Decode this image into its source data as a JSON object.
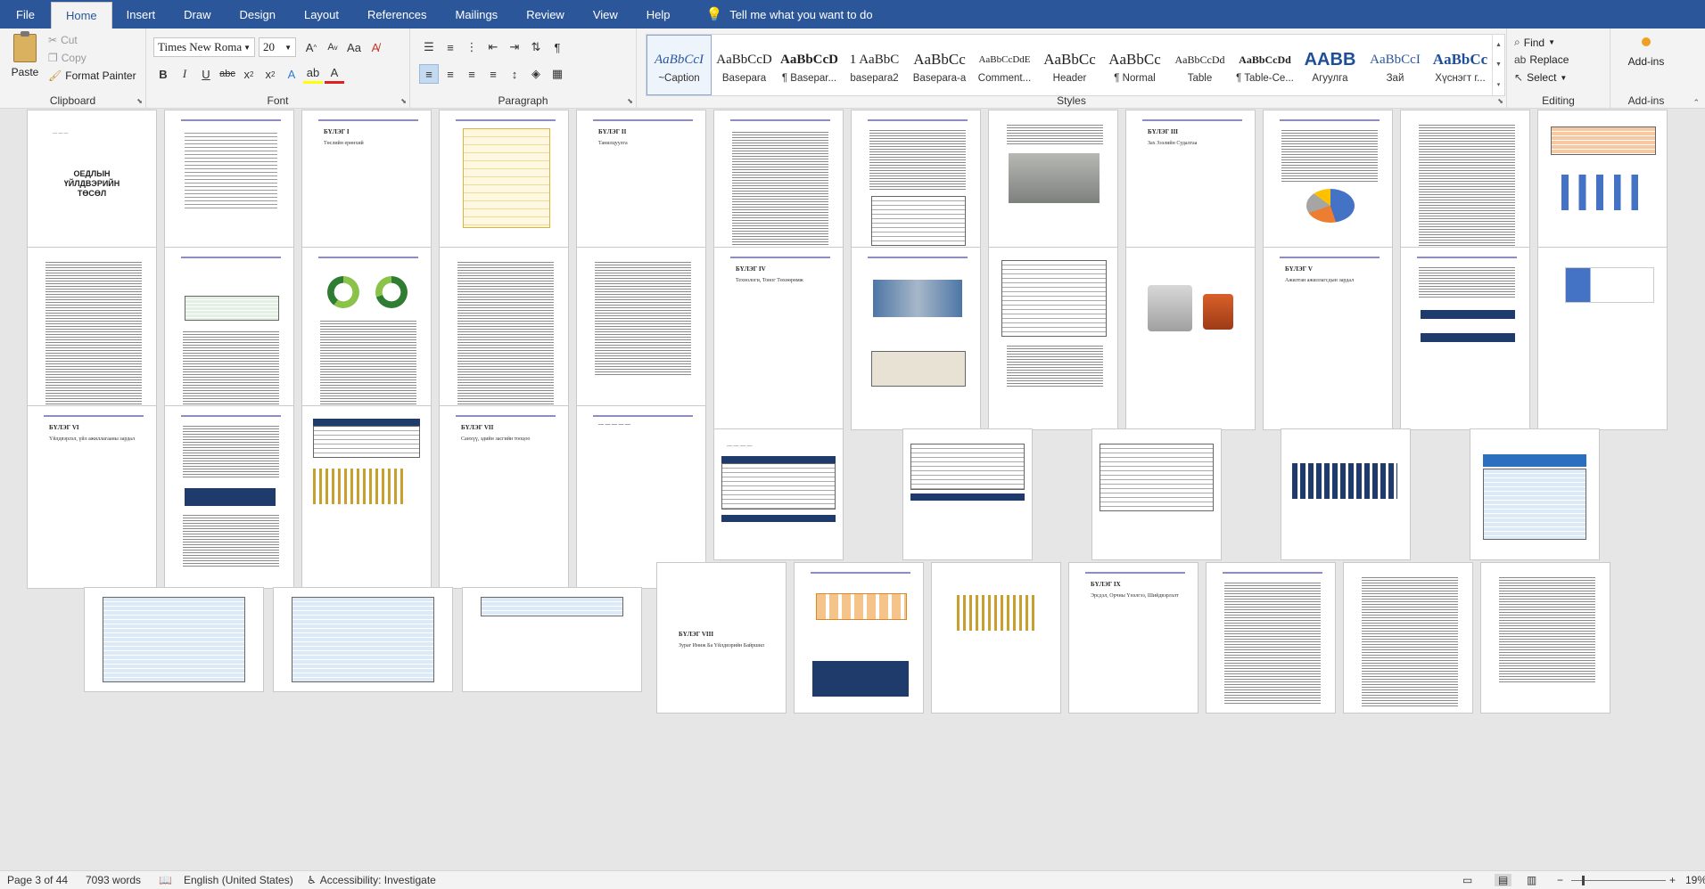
{
  "menu": {
    "tabs": [
      "File",
      "Home",
      "Insert",
      "Draw",
      "Design",
      "Layout",
      "References",
      "Mailings",
      "Review",
      "View",
      "Help"
    ],
    "active": "Home",
    "tellme": "Tell me what you want to do"
  },
  "clipboard": {
    "paste": "Paste",
    "cut": "Cut",
    "copy": "Copy",
    "format_painter": "Format Painter",
    "label": "Clipboard"
  },
  "font": {
    "name": "Times New Roma",
    "size": "20",
    "label": "Font"
  },
  "paragraph": {
    "label": "Paragraph"
  },
  "styles": {
    "label": "Styles",
    "items": [
      {
        "preview": "AaBbCcI",
        "name": "~Caption"
      },
      {
        "preview": "AaBbCcD",
        "name": "Basepara"
      },
      {
        "preview": "AaBbCcD",
        "name": "¶ Basepar..."
      },
      {
        "preview": "1 AaBbC",
        "name": "basepara2"
      },
      {
        "preview": "AaBbCc",
        "name": "Basepara-a"
      },
      {
        "preview": "AaBbCcDdE",
        "name": "Comment..."
      },
      {
        "preview": "AaBbCc",
        "name": "Header"
      },
      {
        "preview": "AaBbCc",
        "name": "¶ Normal"
      },
      {
        "preview": "AaBbCcDd",
        "name": "Table"
      },
      {
        "preview": "AaBbCcDd",
        "name": "¶ Table-Ce..."
      },
      {
        "preview": "AABB",
        "name": "Агуулга"
      },
      {
        "preview": "AaBbCcI",
        "name": "Зай"
      },
      {
        "preview": "AaBbCc",
        "name": "Хүснэгт г..."
      }
    ]
  },
  "editing": {
    "find": "Find",
    "replace": "Replace",
    "select": "Select",
    "label": "Editing"
  },
  "addins": {
    "button": "Add-ins",
    "label": "Add-ins"
  },
  "pages": {
    "cover_title": "ОЕДЛЫН ҮЙЛДВЭРИЙН ТӨСӨЛ",
    "ch1": "БҮЛЭГ I",
    "ch1_sub": "Төслийн ерөнхий",
    "ch2": "БҮЛЭГ II",
    "ch2_sub": "Танилцуулга",
    "ch3": "БҮЛЭГ III",
    "ch3_sub": "Зах Зээлийн Судалгаа",
    "ch4": "БҮЛЭГ IV",
    "ch4_sub": "Технологи, Тоног Төхөөрөмж",
    "ch5": "БҮЛЭГ V",
    "ch5_sub": "Ажилтан ажиллагсдын зардал",
    "ch6": "БҮЛЭГ VI",
    "ch6_sub": "Үйлдвэрлэл, үйл ажиллагааны зардал",
    "ch7": "БҮЛЭГ VII",
    "ch7_sub": "Санхүү, эдийн засгийн тооцоо",
    "ch8": "БҮЛЭГ VIII",
    "ch8_sub": "Зураг Иниж Ба Үйлдвэрийн Байршил",
    "ch9": "БҮЛЭГ IX",
    "ch9_sub": "Эрсдэл, Орчны Үнэлгээ, Шийдвэрлэлт"
  },
  "status": {
    "page": "Page 3 of 44",
    "words": "7093 words",
    "language": "English (United States)",
    "accessibility": "Accessibility: Investigate",
    "zoom": "19%"
  }
}
